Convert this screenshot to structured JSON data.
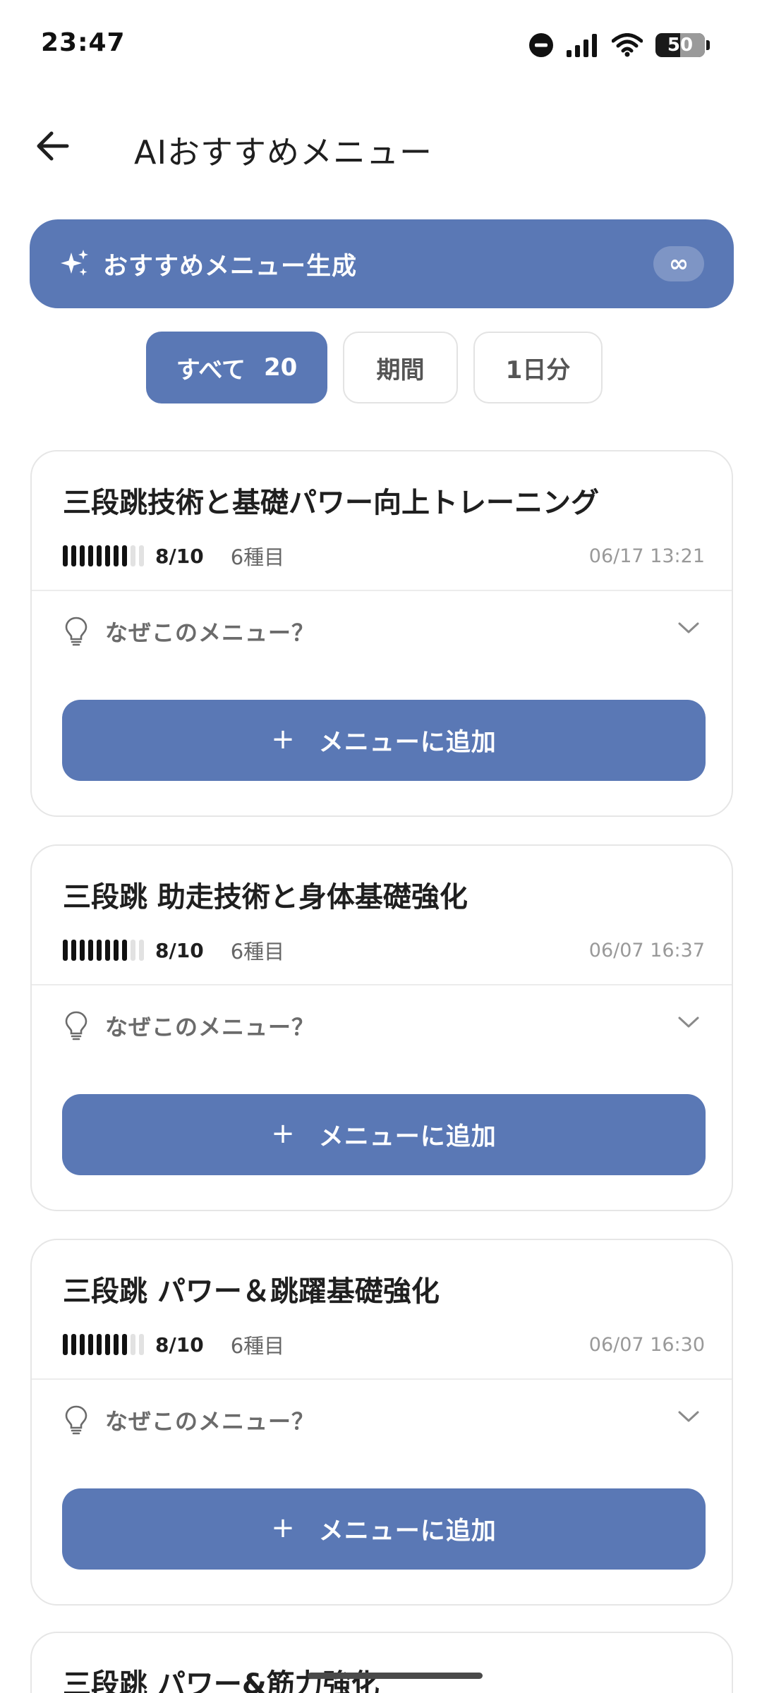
{
  "status_bar": {
    "time": "23:47",
    "battery": "50",
    "battery_level": 0.5,
    "icons": [
      "do-not-disturb-icon",
      "signal-icon",
      "wifi-icon",
      "battery-icon"
    ]
  },
  "header": {
    "back_icon": "arrow-left-icon",
    "title": "AIおすすめメニュー"
  },
  "generate": {
    "icon": "sparkles-icon",
    "label": "おすすめメニュー生成",
    "badge": "∞"
  },
  "filters": {
    "all_label": "すべて",
    "all_count": "20",
    "period_label": "期間",
    "day_label": "1日分",
    "active": "all"
  },
  "colors": {
    "accent": "#5a78b5",
    "text": "#1f1f1f",
    "muted": "#6b6b6b",
    "border": "#e6e6e6"
  },
  "cards": [
    {
      "title": "三段跳技術と基礎パワー向上トレーニング",
      "level": "8/10",
      "level_value": 8,
      "level_max": 10,
      "kinds": "6種目",
      "date": "06/17 13:21",
      "why_label": "なぜこのメニュー？",
      "add_label": "メニューに追加",
      "add_icon": "+"
    },
    {
      "title": "三段跳 助走技術と身体基礎強化",
      "level": "8/10",
      "level_value": 8,
      "level_max": 10,
      "kinds": "6種目",
      "date": "06/07 16:37",
      "why_label": "なぜこのメニュー？",
      "add_label": "メニューに追加",
      "add_icon": "+"
    },
    {
      "title": "三段跳 パワー＆跳躍基礎強化",
      "level": "8/10",
      "level_value": 8,
      "level_max": 10,
      "kinds": "6種目",
      "date": "06/07 16:30",
      "why_label": "なぜこのメニュー？",
      "add_label": "メニューに追加",
      "add_icon": "+"
    },
    {
      "title": "三段跳 パワー&筋力強化"
    }
  ]
}
